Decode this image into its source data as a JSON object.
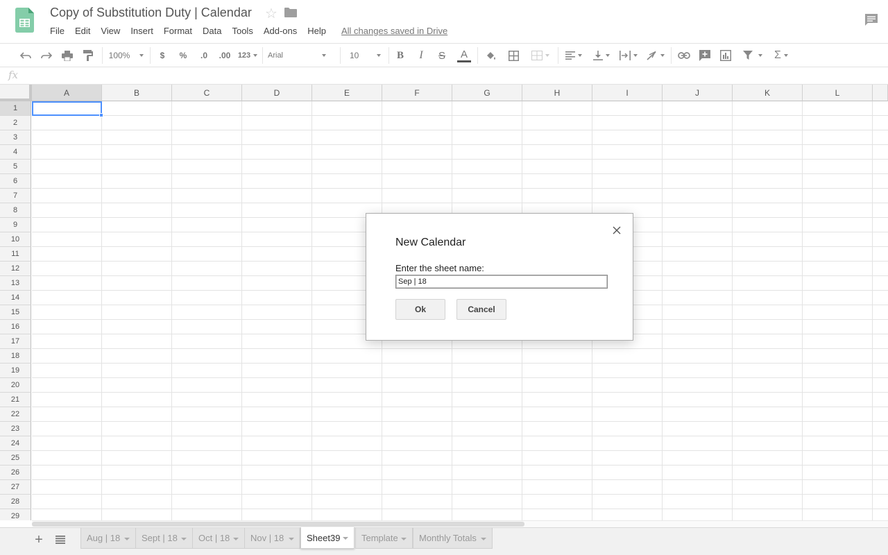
{
  "header": {
    "doc_title": "Copy of Substitution Duty | Calendar",
    "menu": [
      "File",
      "Edit",
      "View",
      "Insert",
      "Format",
      "Data",
      "Tools",
      "Add-ons",
      "Help"
    ],
    "save_status": "All changes saved in Drive"
  },
  "toolbar": {
    "zoom": "100%",
    "currency": "$",
    "percent": "%",
    "decrease_decimals": ".0",
    "increase_decimals": ".00",
    "more_formats": "123",
    "font": "Arial",
    "font_size": "10",
    "bold": "B",
    "italic": "I",
    "strikethrough": "S",
    "text_color": "A"
  },
  "formula_bar": {
    "icon": "fx",
    "value": ""
  },
  "grid": {
    "columns": [
      "A",
      "B",
      "C",
      "D",
      "E",
      "F",
      "G",
      "H",
      "I",
      "J",
      "K",
      "L"
    ],
    "rows": [
      "1",
      "2",
      "3",
      "4",
      "5",
      "6",
      "7",
      "8",
      "9",
      "10",
      "11",
      "12",
      "13",
      "14",
      "15",
      "16",
      "17",
      "18",
      "19",
      "20",
      "21",
      "22",
      "23",
      "24",
      "25",
      "26",
      "27",
      "28",
      "29"
    ],
    "active_cell": "A1"
  },
  "sheet_tabs": {
    "tabs": [
      "Aug | 18",
      "Sept | 18",
      "Oct | 18",
      "Nov | 18",
      "Sheet39",
      "Template",
      "Monthly Totals"
    ],
    "active": "Sheet39"
  },
  "dialog": {
    "title": "New Calendar",
    "label": "Enter the sheet name:",
    "input_value": "Sep | 18",
    "ok_label": "Ok",
    "cancel_label": "Cancel"
  },
  "colors": {
    "selection": "#4d90fe",
    "sheets_green": "#1fa463"
  }
}
